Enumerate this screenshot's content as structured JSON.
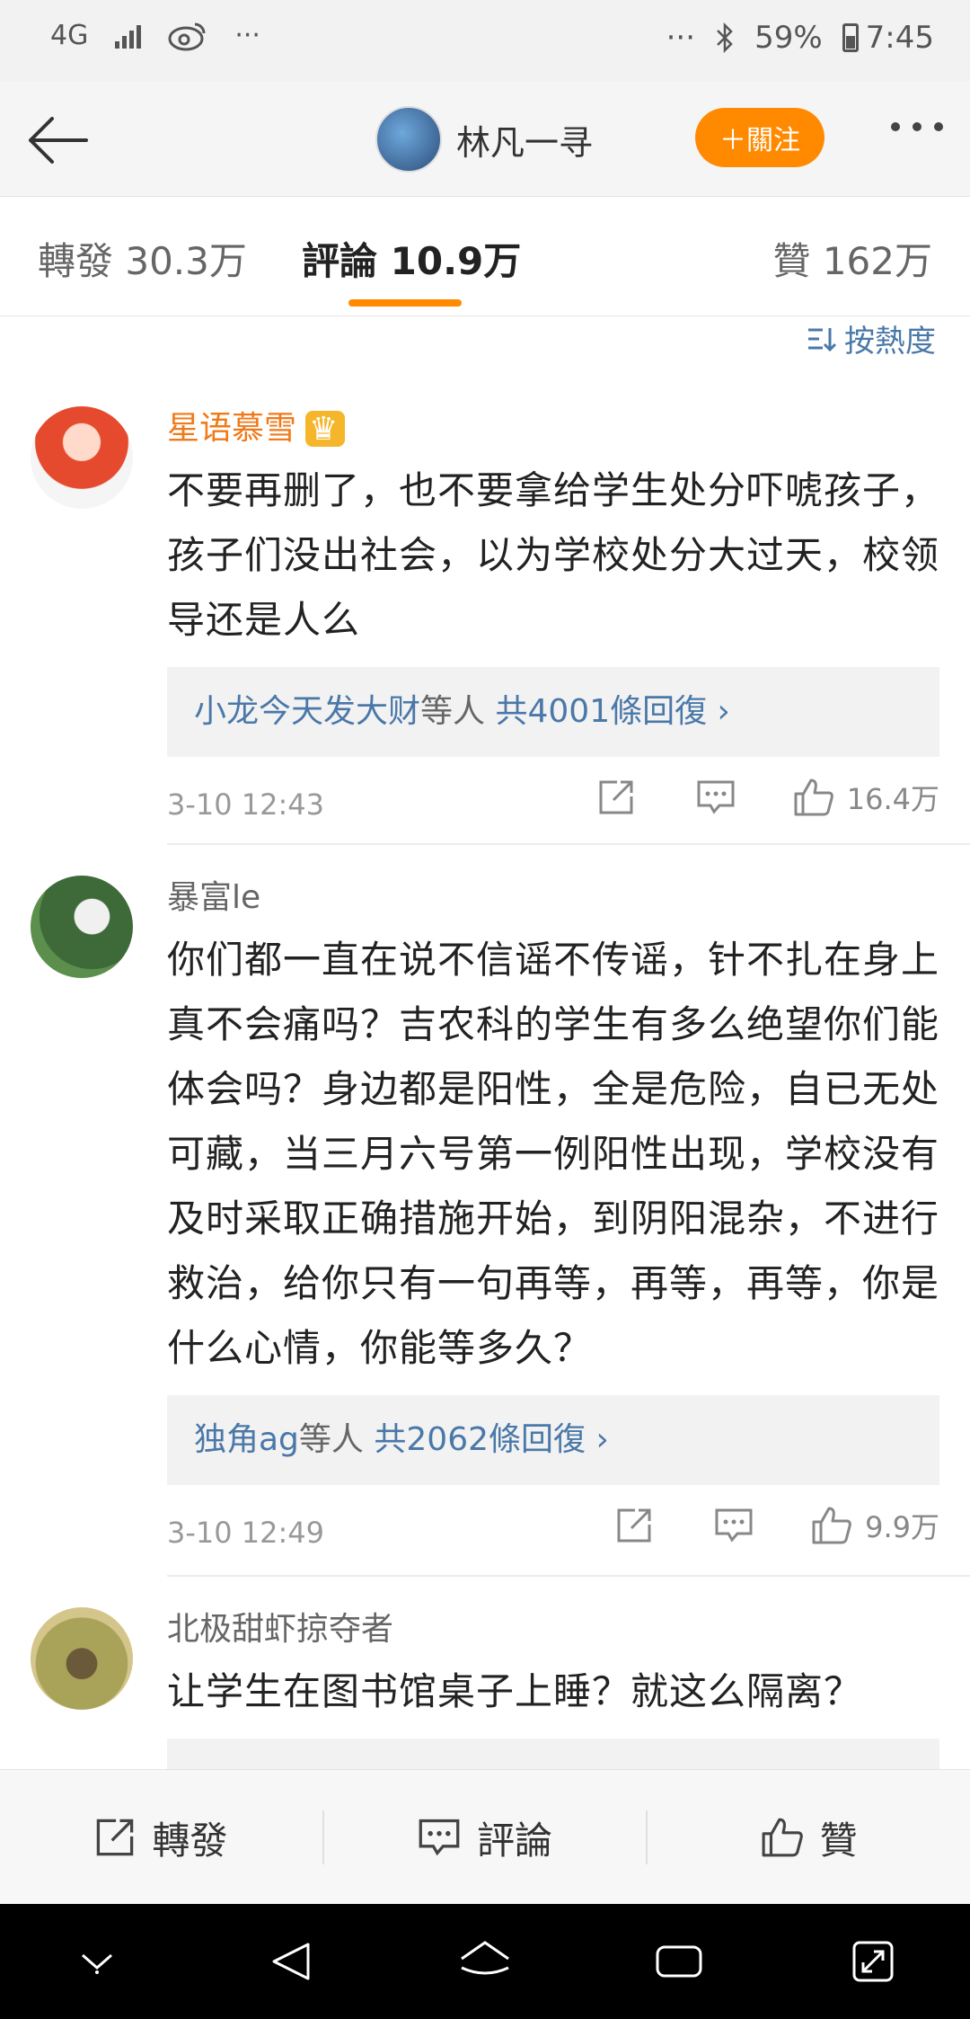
{
  "status_bar": {
    "network": "4G",
    "more": "···",
    "right_more": "···",
    "battery": "59%",
    "time": "7:45"
  },
  "header": {
    "author_name": "林凡一寻",
    "follow_label": "＋關注"
  },
  "tabs": [
    {
      "label": "轉發 30.3万"
    },
    {
      "label": "評論 10.9万"
    },
    {
      "label": "贊 162万"
    }
  ],
  "sort_label": "按熱度",
  "comments": [
    {
      "name": "星语慕雪",
      "text": "不要再删了，也不要拿给学生处分吓唬孩子，孩子们没出社会，以为学校处分大过天，校领导还是人么",
      "reply_names": "小龙今天发大财",
      "reply_mid": "等人",
      "reply_count": "共4001條回復 ›",
      "time": "3-10 12:43",
      "likes": "16.4万"
    },
    {
      "name": "暴富le",
      "text": "你们都一直在说不信谣不传谣，针不扎在身上真不会痛吗？吉农科的学生有多么绝望你们能体会吗？身边都是阳性，全是危险，自已无处可藏，当三月六号第一例阳性出现，学校没有及时采取正确措施开始，到阴阳混杂，不进行救治，给你只有一句再等，再等，再等，你是什么心情，你能等多久？",
      "reply_names": "独角ag",
      "reply_mid": "等人",
      "reply_count": "共2062條回復 ›",
      "time": "3-10 12:49",
      "likes": "9.9万"
    },
    {
      "name": "北极甜虾掠夺者",
      "text": "让学生在图书馆桌子上睡？就这么隔离？"
    }
  ],
  "action_bar": {
    "repost": "轉發",
    "comment": "評論",
    "like": "贊"
  },
  "colors": {
    "accent": "#ff8a00",
    "link": "#4a78a8",
    "vip_name": "#f07a1a"
  }
}
